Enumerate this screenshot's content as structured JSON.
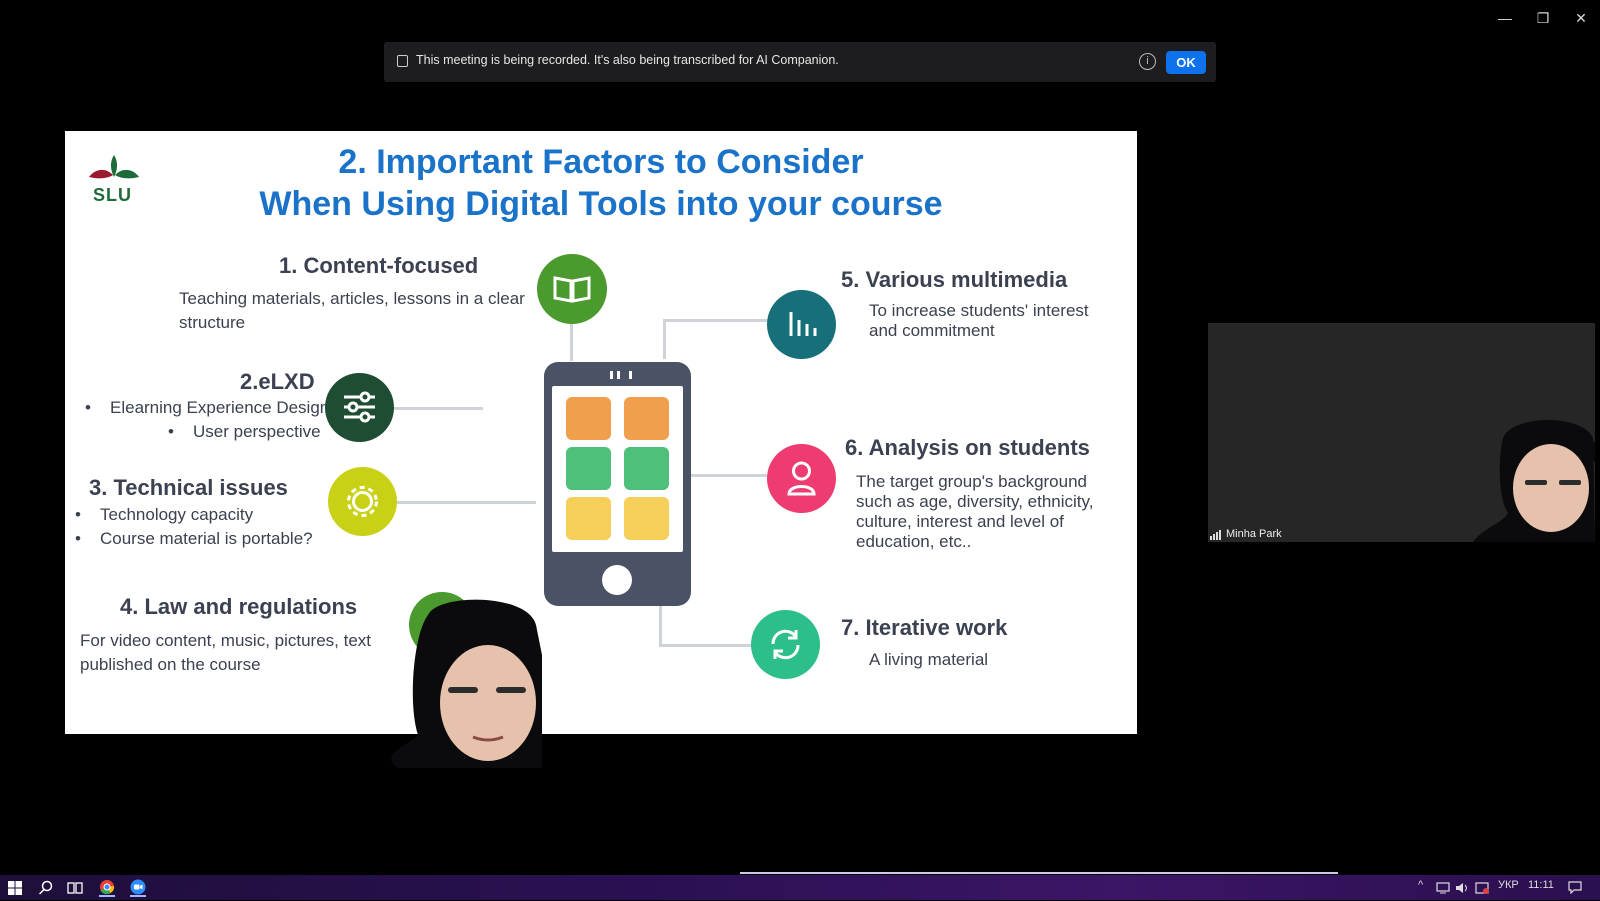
{
  "window": {
    "minimize": "—",
    "restore": "❐",
    "close": "✕"
  },
  "banner": {
    "message": "This meeting is being recorded. It's also being transcribed for AI Companion.",
    "info_icon": "info-icon",
    "ok_label": "OK"
  },
  "slide": {
    "logo_text": "SLU",
    "title_line1": "2. Important Factors to Consider",
    "title_line2": "When Using Digital Tools into your course",
    "items": [
      {
        "heading": "1. Content-focused",
        "body": "Teaching materials, articles, lessons in a clear structure",
        "icon": "book-icon",
        "color": "#4a9a2e"
      },
      {
        "heading": "2.eLXD",
        "bullets": [
          "Elearning Experience Design",
          "User perspective"
        ],
        "icon": "sliders-icon",
        "color": "#1f4d33"
      },
      {
        "heading": "3. Technical issues",
        "bullets": [
          "Technology capacity",
          "Course material is portable?"
        ],
        "icon": "gear-icon",
        "color": "#c8d116"
      },
      {
        "heading": "4. Law and regulations",
        "body": "For video content, music, pictures, text published on the course",
        "icon": "law-icon",
        "color": "#4a9a2e"
      },
      {
        "heading": "5. Various multimedia",
        "body": "To increase students' interest and commitment",
        "icon": "bar-chart-icon",
        "color": "#166f79"
      },
      {
        "heading": "6. Analysis on students",
        "body": "The target group's background such as age, diversity, ethnicity, culture, interest and level of education, etc..",
        "icon": "person-icon",
        "color": "#ee3b72"
      },
      {
        "heading": "7. Iterative work",
        "body": "A living material",
        "icon": "refresh-icon",
        "color": "#2cbf8a"
      }
    ]
  },
  "participant": {
    "name": "Minha Park"
  },
  "taskbar": {
    "lang": "УКР",
    "time": "11:11"
  }
}
